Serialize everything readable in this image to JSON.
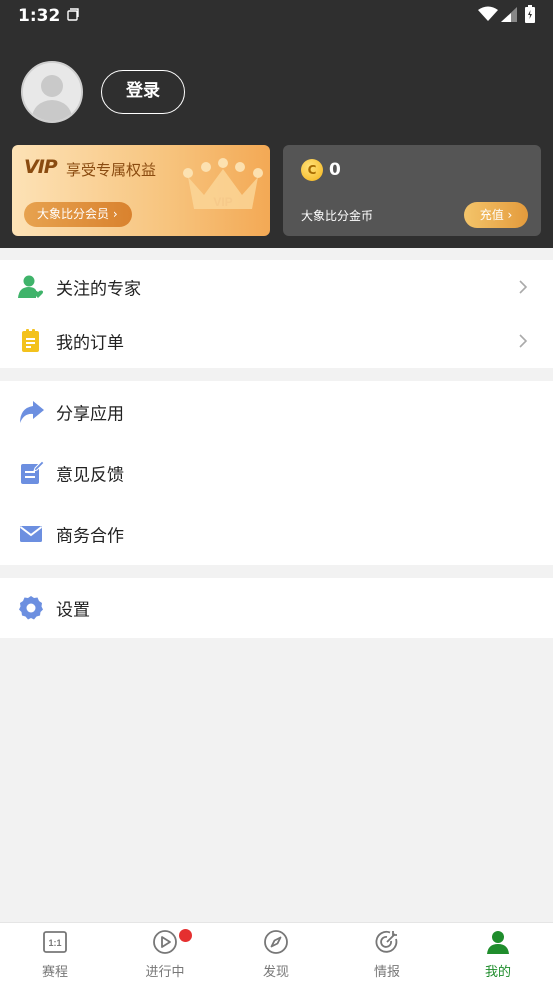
{
  "status_bar": {
    "time": "1:32"
  },
  "profile": {
    "login_label": "登录"
  },
  "vip_card": {
    "logo": "VIP",
    "title": "享受专属权益",
    "crown_text": "VIP",
    "button_label": "大象比分会员 ›"
  },
  "coin_card": {
    "coin_symbol": "C",
    "count": "0",
    "label": "大象比分金币",
    "recharge_label": "充值 ›"
  },
  "menu_group_1": [
    {
      "label": "关注的专家",
      "icon": "user-heart-icon"
    },
    {
      "label": "我的订单",
      "icon": "order-clipboard-icon"
    }
  ],
  "menu_group_2": [
    {
      "label": "分享应用",
      "icon": "share-arrow-icon"
    },
    {
      "label": "意见反馈",
      "icon": "feedback-note-icon"
    },
    {
      "label": "商务合作",
      "icon": "mail-icon"
    }
  ],
  "menu_group_3": [
    {
      "label": "设置",
      "icon": "gear-icon"
    }
  ],
  "tabbar": [
    {
      "label": "赛程",
      "icon": "schedule-icon",
      "badge_text": "1:1"
    },
    {
      "label": "进行中",
      "icon": "play-circle-icon"
    },
    {
      "label": "发现",
      "icon": "compass-icon"
    },
    {
      "label": "情报",
      "icon": "target-icon"
    },
    {
      "label": "我的",
      "icon": "person-icon"
    }
  ],
  "colors": {
    "accent_green": "#1f8d2c",
    "header_bg": "#2f2f2f",
    "vip_gold": "#f3a955",
    "badge_red": "#e53030"
  }
}
